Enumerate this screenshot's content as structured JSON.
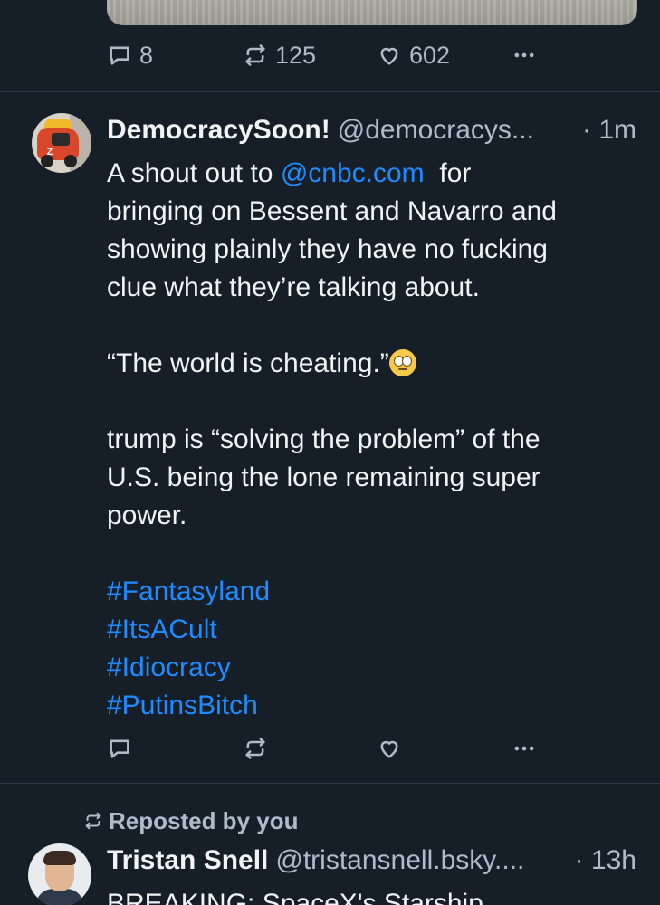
{
  "top_post": {
    "replies": "8",
    "reposts": "125",
    "likes": "602"
  },
  "post": {
    "display_name": "DemocracySoon!",
    "handle": "@democracys...",
    "time": "· 1m",
    "line1_pre": "A shout out to ",
    "mention": "@cnbc.com",
    "line1_post": "  for",
    "text_lines_a": [
      "bringing on Bessent and Navarro and",
      "showing plainly they have no fucking",
      "clue what they’re talking about."
    ],
    "quote": "“The world is cheating.”",
    "text_lines_b": [
      "trump is “solving the problem” of the",
      "U.S. being the lone remaining super",
      "power."
    ],
    "hashtags": [
      "#Fantasyland",
      "#ItsACult",
      "#Idiocracy",
      "#PutinsBitch"
    ]
  },
  "repost": {
    "label": "Reposted by you",
    "display_name": "Tristan Snell",
    "handle": "@tristansnell.bsky....",
    "time": "· 13h",
    "text": "BREAKING: SpaceX's Starship"
  },
  "colors": {
    "background": "#161e27",
    "link": "#208bfe",
    "muted": "#aebbc9",
    "text": "#f1f3f5"
  },
  "icons": {
    "reply": "speech-bubble-icon",
    "repost": "repost-arrows-icon",
    "like": "heart-icon",
    "more": "ellipsis-icon"
  }
}
